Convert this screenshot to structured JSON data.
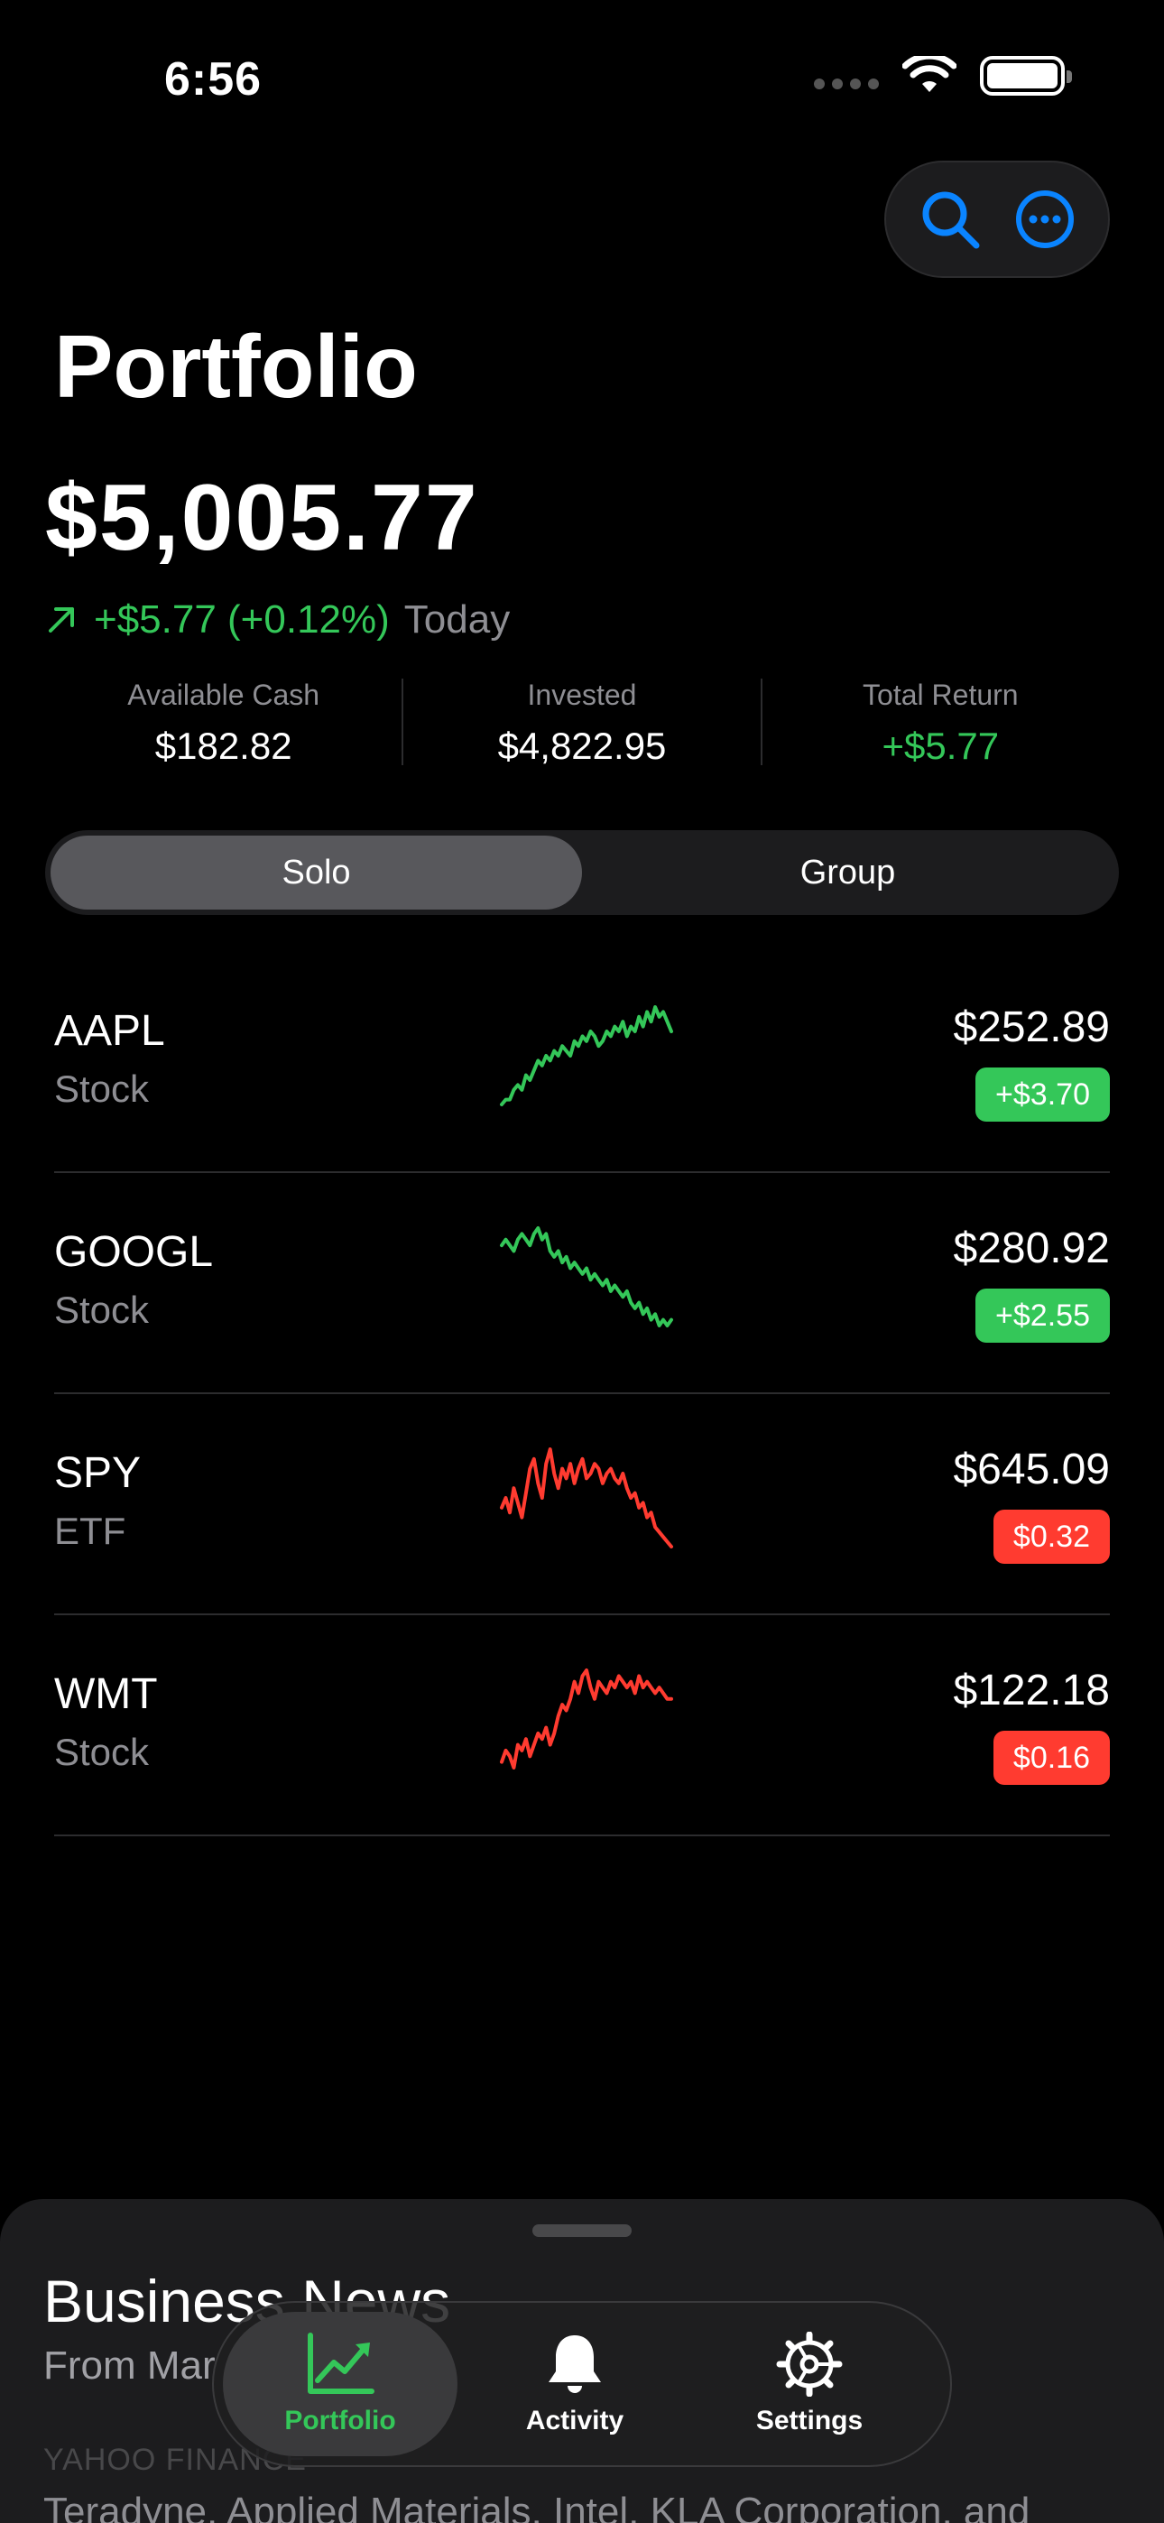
{
  "status_bar": {
    "time": "6:56"
  },
  "header": {
    "title": "Portfolio",
    "total_value": "$5,005.77",
    "change": "+$5.77 (+0.12%)",
    "change_period": "Today",
    "change_color": "#34c759"
  },
  "top_actions": {
    "icons": [
      "search-icon",
      "more-icon"
    ],
    "accent": "#0a84ff"
  },
  "stats": [
    {
      "label": "Available Cash",
      "value": "$182.82"
    },
    {
      "label": "Invested",
      "value": "$4,822.95"
    },
    {
      "label": "Total Return",
      "value": "+$5.77"
    }
  ],
  "segment": {
    "options": [
      "Solo",
      "Group"
    ],
    "selected": "Solo"
  },
  "holdings": [
    {
      "ticker": "AAPL",
      "type": "Stock",
      "price": "$252.89",
      "change": "+$3.70",
      "direction": "up",
      "sparkline": [
        2,
        3,
        3,
        5,
        6,
        5,
        8,
        7,
        9,
        11,
        10,
        12,
        11,
        13,
        12,
        14,
        13,
        12,
        15,
        14,
        16,
        15,
        17,
        16,
        14,
        15,
        17,
        16,
        18,
        17,
        19,
        16,
        18,
        17,
        20,
        18,
        21,
        19,
        22,
        20,
        21,
        19,
        17
      ]
    },
    {
      "ticker": "GOOGL",
      "type": "Stock",
      "price": "$280.92",
      "change": "+$2.55",
      "direction": "up",
      "sparkline": [
        20,
        21,
        20,
        19,
        21,
        22,
        21,
        20,
        22,
        23,
        21,
        22,
        19,
        18,
        19,
        17,
        18,
        16,
        17,
        16,
        15,
        16,
        14,
        15,
        14,
        13,
        14,
        12,
        13,
        12,
        11,
        12,
        10,
        9,
        10,
        8,
        9,
        7,
        8,
        6,
        7,
        6,
        7
      ]
    },
    {
      "ticker": "SPY",
      "type": "ETF",
      "price": "$645.09",
      "change": "$0.32",
      "direction": "down",
      "sparkline": [
        10,
        12,
        9,
        14,
        11,
        8,
        13,
        18,
        20,
        15,
        12,
        19,
        22,
        17,
        14,
        18,
        16,
        19,
        15,
        18,
        20,
        16,
        17,
        19,
        18,
        15,
        17,
        18,
        16,
        15,
        17,
        14,
        12,
        13,
        10,
        11,
        8,
        9,
        6,
        5,
        4,
        3,
        2
      ]
    },
    {
      "ticker": "WMT",
      "type": "Stock",
      "price": "$122.18",
      "change": "$0.16",
      "direction": "down",
      "sparkline": [
        4,
        6,
        5,
        3,
        7,
        6,
        8,
        5,
        7,
        9,
        8,
        10,
        7,
        9,
        12,
        14,
        13,
        15,
        18,
        16,
        19,
        20,
        17,
        15,
        18,
        17,
        16,
        18,
        17,
        19,
        18,
        17,
        18,
        16,
        19,
        17,
        18,
        17,
        16,
        17,
        16,
        15,
        15
      ]
    }
  ],
  "colors": {
    "up": "#34c759",
    "down": "#ff3b30"
  },
  "news_sheet": {
    "title": "Business News",
    "subtitle": "From Mar",
    "source": "YAHOO FINANCE",
    "headline": "Teradyne, Applied Materials, Intel, KLA Corporation, and"
  },
  "tabbar": {
    "tabs": [
      {
        "label": "Portfolio",
        "icon": "chart-icon",
        "active": true
      },
      {
        "label": "Activity",
        "icon": "bell-icon",
        "active": false
      },
      {
        "label": "Settings",
        "icon": "gear-icon",
        "active": false
      }
    ]
  }
}
